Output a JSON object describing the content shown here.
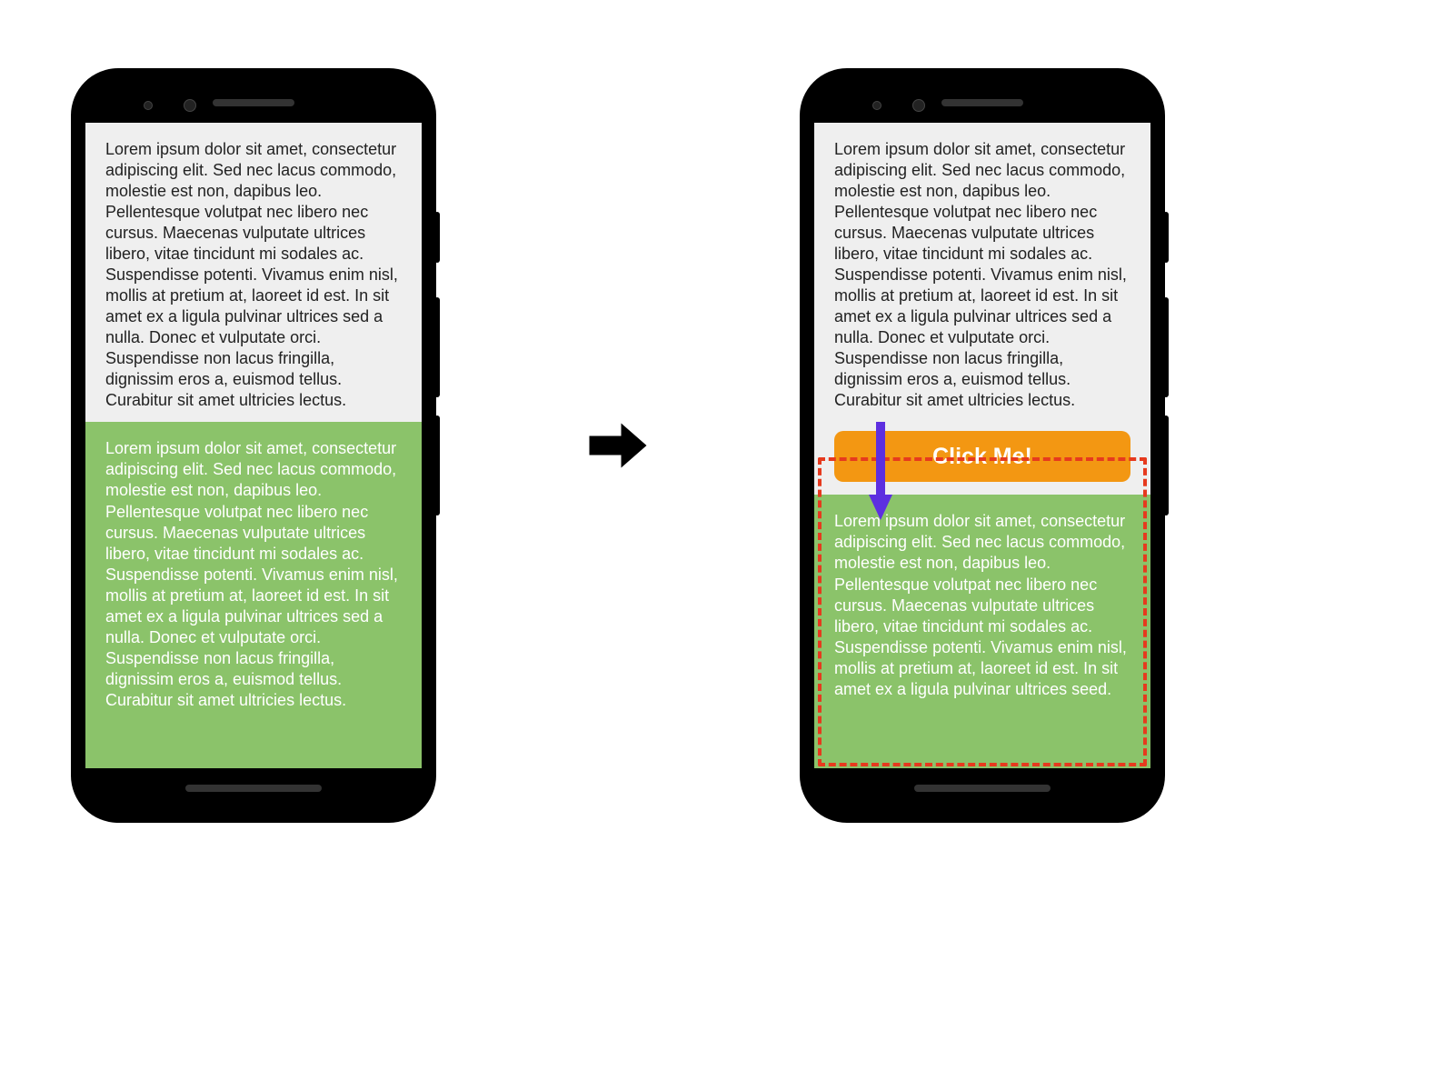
{
  "colors": {
    "phone_frame": "#000000",
    "screen_bg": "#efefef",
    "green_block": "#8bc36a",
    "button_bg": "#f39712",
    "dashed_border": "#e63a1e",
    "down_arrow": "#5d2fe0",
    "transition_arrow": "#000000"
  },
  "left_phone": {
    "top_text": "Lorem ipsum dolor sit amet, consectetur adipiscing elit. Sed nec lacus commodo, molestie est non, dapibus leo. Pellentesque volutpat nec libero nec cursus. Maecenas vulputate ultrices libero, vitae tincidunt mi sodales ac. Suspendisse potenti. Vivamus enim nisl, mollis at pretium at, laoreet id est. In sit amet ex a ligula pulvinar ultrices sed a nulla. Donec et vulputate orci. Suspendisse non lacus fringilla, dignissim eros a, euismod tellus. Curabitur sit amet ultricies lectus.",
    "green_text": "Lorem ipsum dolor sit amet, consectetur adipiscing elit. Sed nec lacus commodo, molestie est non, dapibus leo. Pellentesque volutpat nec libero nec cursus. Maecenas vulputate ultrices libero, vitae tincidunt mi sodales ac. Suspendisse potenti. Vivamus enim nisl, mollis at pretium at, laoreet id est. In sit amet ex a ligula pulvinar ultrices sed a nulla. Donec et vulputate orci. Suspendisse non lacus fringilla, dignissim eros a, euismod tellus. Curabitur sit amet ultricies lectus."
  },
  "right_phone": {
    "top_text": "Lorem ipsum dolor sit amet, consectetur adipiscing elit. Sed nec lacus commodo, molestie est non, dapibus leo. Pellentesque volutpat nec libero nec cursus. Maecenas vulputate ultrices libero, vitae tincidunt mi sodales ac. Suspendisse potenti. Vivamus enim nisl, mollis at pretium at, laoreet id est. In sit amet ex a ligula pulvinar ultrices sed a nulla. Donec et vulputate orci. Suspendisse non lacus fringilla, dignissim eros a, euismod tellus. Curabitur sit amet ultricies lectus.",
    "button_label": "Click Me!",
    "green_text": "Lorem ipsum dolor sit amet, consectetur adipiscing elit. Sed nec lacus commodo, molestie est non, dapibus leo. Pellentesque volutpat nec libero nec cursus. Maecenas vulputate ultrices libero, vitae tincidunt mi sodales ac. Suspendisse potenti. Vivamus enim nisl, mollis at pretium at, laoreet id est. In sit amet ex a ligula pulvinar ultrices seed."
  }
}
